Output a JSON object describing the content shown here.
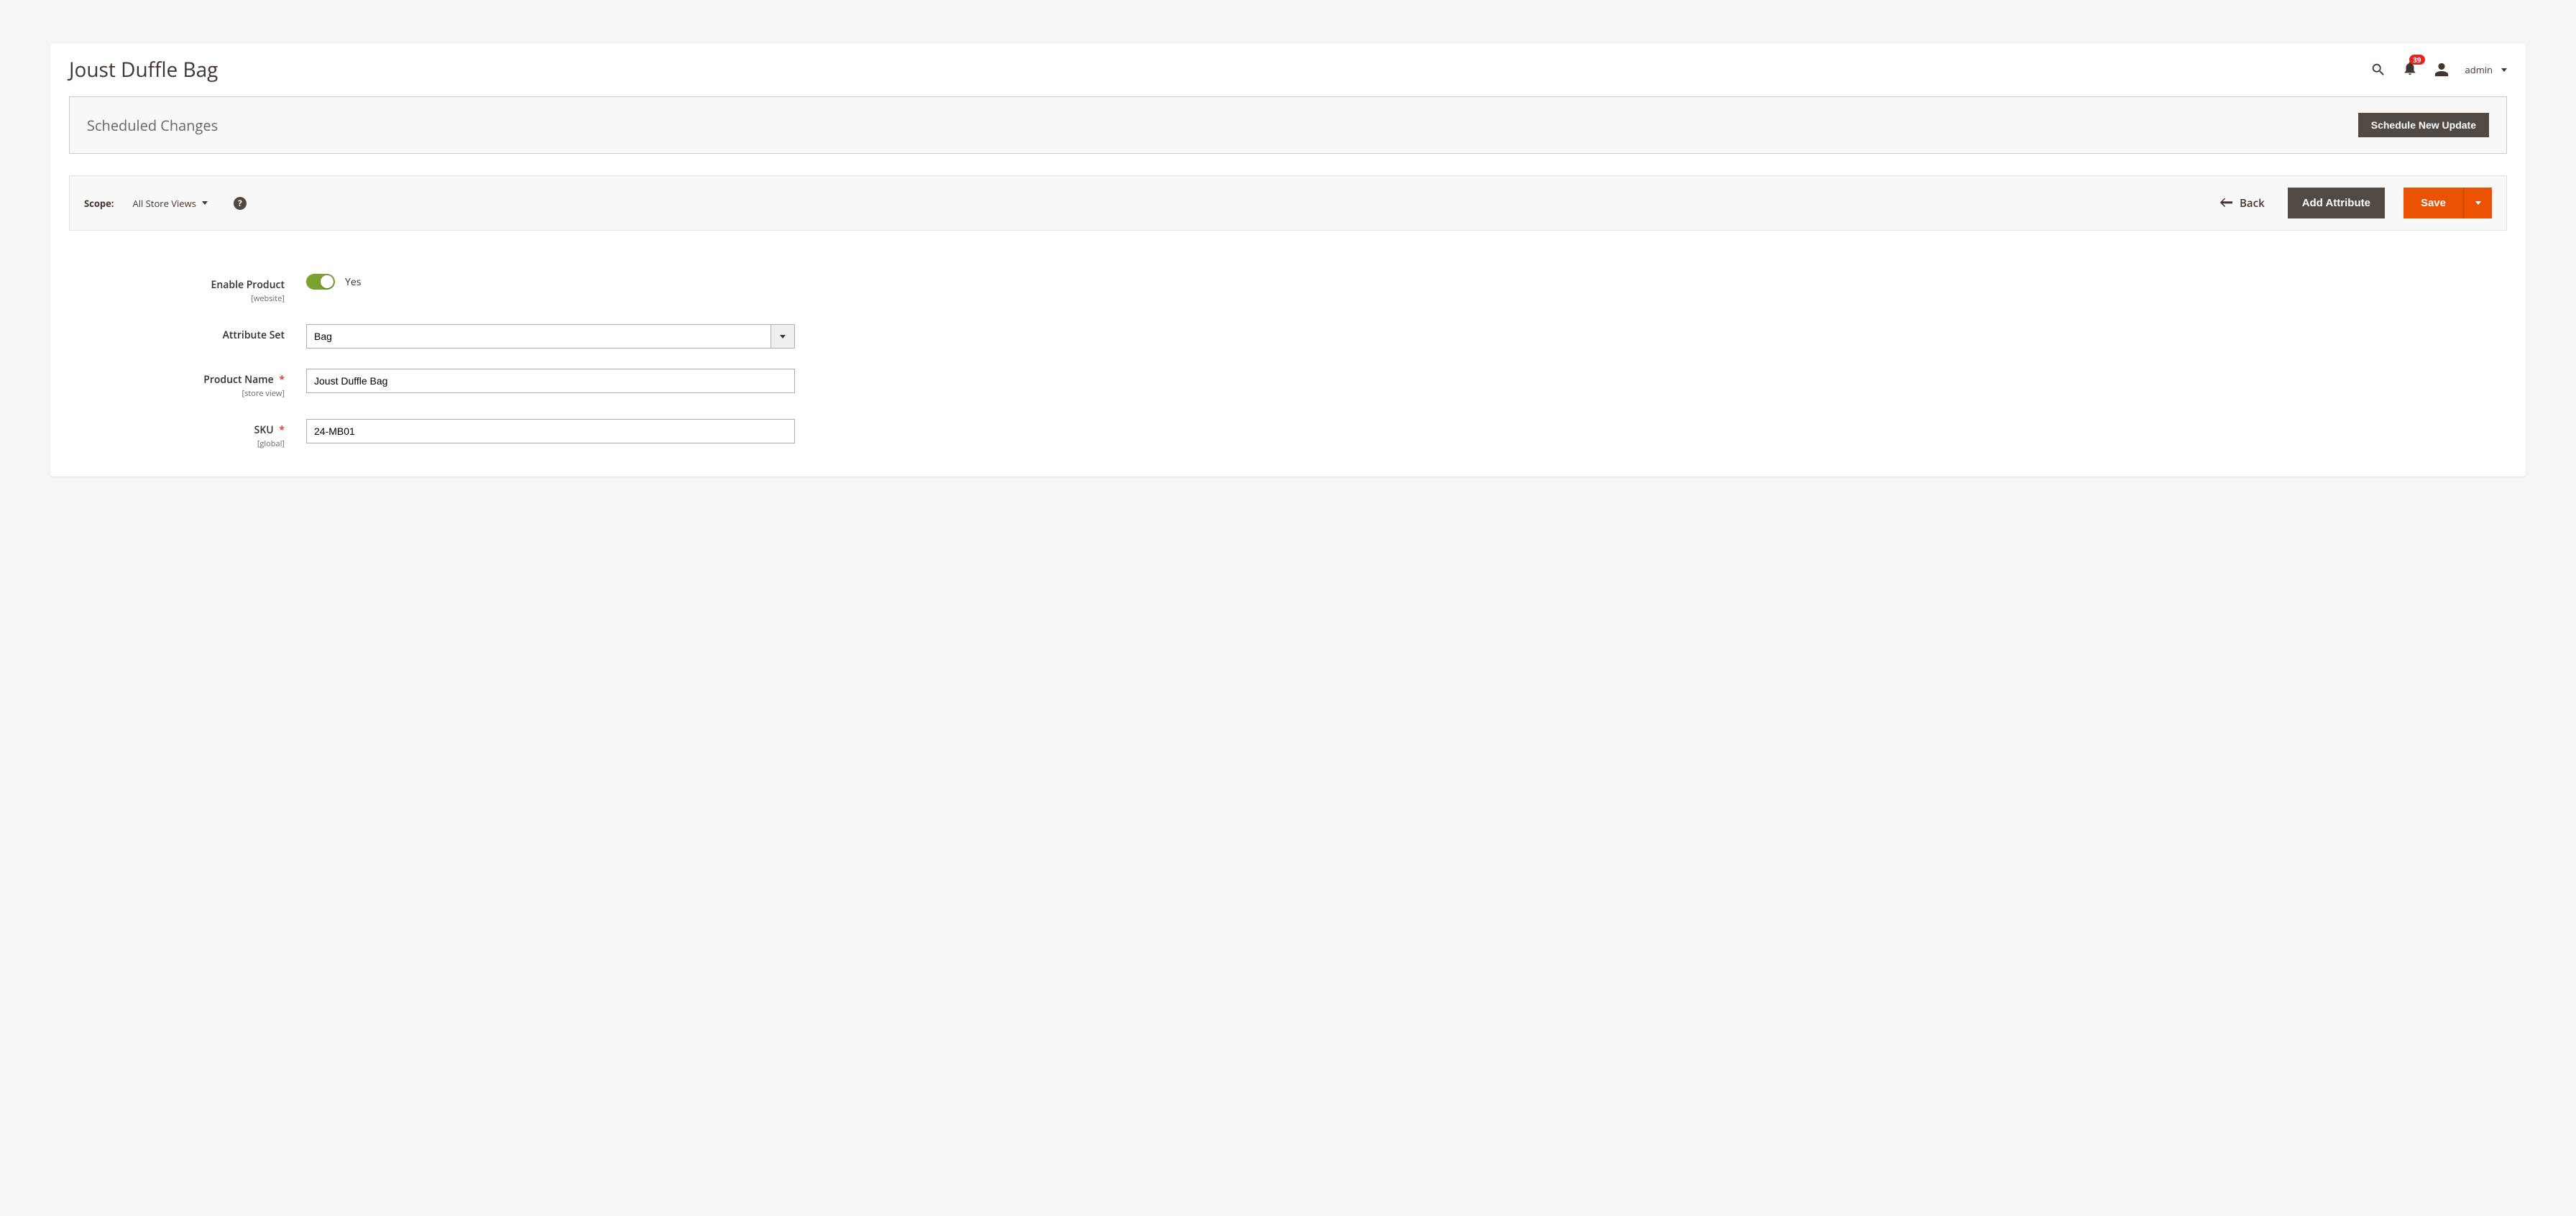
{
  "header": {
    "title": "Joust Duffle Bag",
    "notification_count": "39",
    "user_label": "admin"
  },
  "scheduled": {
    "title": "Scheduled Changes",
    "button": "Schedule New Update"
  },
  "toolbar": {
    "scope_label": "Scope:",
    "scope_value": "All Store Views",
    "back_label": "Back",
    "add_attribute_label": "Add Attribute",
    "save_label": "Save"
  },
  "form": {
    "enable_product": {
      "label": "Enable Product",
      "scope": "[website]",
      "value_text": "Yes"
    },
    "attribute_set": {
      "label": "Attribute Set",
      "value": "Bag"
    },
    "product_name": {
      "label": "Product Name",
      "scope": "[store view]",
      "value": "Joust Duffle Bag"
    },
    "sku": {
      "label": "SKU",
      "scope": "[global]",
      "value": "24-MB01"
    }
  }
}
